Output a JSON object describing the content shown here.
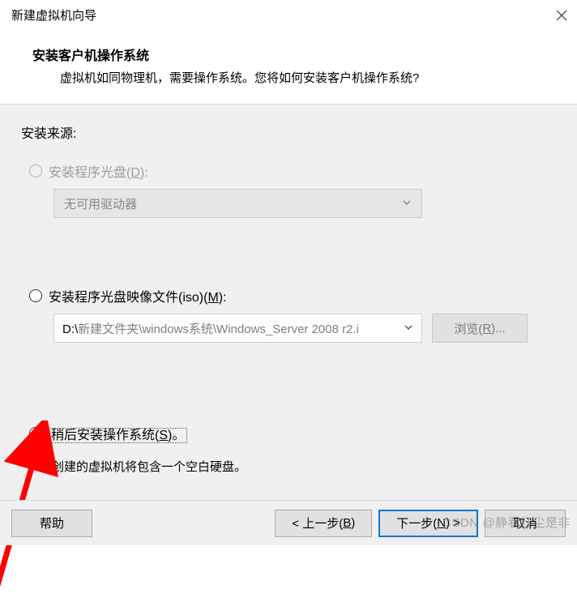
{
  "window": {
    "title": "新建虚拟机向导"
  },
  "header": {
    "title": "安装客户机操作系统",
    "description": "虚拟机如同物理机，需要操作系统。您将如何安装客户机操作系统?"
  },
  "sourceLabel": "安装来源:",
  "options": {
    "disc": {
      "label_prefix": "安装程序光盘(",
      "label_key": "D",
      "label_suffix": "):",
      "dropdown_value": "无可用驱动器",
      "enabled": false,
      "selected": false
    },
    "iso": {
      "label_prefix": "安装程序光盘映像文件(iso)(",
      "label_key": "M",
      "label_suffix": "):",
      "path_prefix": "D:\\",
      "path_rest": "新建文件夹\\windows系统\\Windows_Server 2008 r2.i",
      "browse_prefix": "浏览(",
      "browse_key": "R",
      "browse_suffix": ")...",
      "enabled": true,
      "selected": false
    },
    "later": {
      "label_prefix": "稍后安装操作系统(",
      "label_key": "S",
      "label_suffix": ")。",
      "hint": "创建的虚拟机将包含一个空白硬盘。",
      "selected": true
    }
  },
  "footer": {
    "help": "帮助",
    "back_prefix": "< 上一步(",
    "back_key": "B",
    "back_suffix": ")",
    "next_prefix": "下一步(",
    "next_key": "N",
    "next_suffix": ") >",
    "cancel": "取消"
  },
  "watermark": "CSDN @静看红尘是非"
}
